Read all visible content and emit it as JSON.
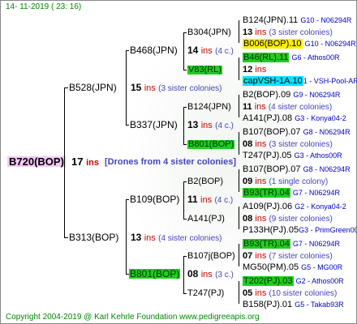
{
  "header": "14- 11-2019 ( 23: 16)",
  "footer": "Copyright 2004-2019 @ Karl Kehrle Foundation   www.pedigreeapis.org",
  "root": {
    "name": "B720(BOP)",
    "count": "17",
    "ins": "ins",
    "note": "[Drones from 4 sister colonies]"
  },
  "gen1": [
    {
      "name": "B528(JPN)",
      "count": "15",
      "ins": "ins",
      "note": "(3 sister colonies)"
    },
    {
      "name": "B313(BOP)",
      "count": "13",
      "ins": "ins",
      "note": "(4 sister colonies)"
    }
  ],
  "gen2": [
    {
      "name": "B468(JPN)",
      "count": "14",
      "ins": "ins",
      "note": "(4 c.)"
    },
    {
      "name": "B337(JPN)",
      "count": "13",
      "ins": "ins",
      "note": "(4 c.)"
    },
    {
      "name": "B109(BOP)",
      "count": "11",
      "ins": "ins",
      "note": "(4 c.)"
    },
    {
      "name": "B801(BOP)",
      "count": "08",
      "ins": "ins",
      "note": "(3 c.)"
    }
  ],
  "gen3": [
    {
      "name": "B304(JPN)",
      "count": "",
      "ins": "",
      "note": ""
    },
    {
      "name": "V83(RL)",
      "count": "12",
      "ins": "ins",
      "note": ""
    },
    {
      "name": "B124(JPN)",
      "count": "",
      "ins": "",
      "note": ""
    },
    {
      "name": "B801(BOP)",
      "count": "",
      "ins": "",
      "note": ""
    },
    {
      "name": "B2(BOP)",
      "count": "",
      "ins": "",
      "note": ""
    },
    {
      "name": "A141(PJ)",
      "count": "",
      "ins": "",
      "note": ""
    },
    {
      "name": "B107j(BOP)",
      "count": "",
      "ins": "",
      "note": ""
    },
    {
      "name": "T247(PJ)",
      "count": "",
      "ins": "",
      "note": ""
    }
  ],
  "gen4": [
    {
      "name": "B124(JPN).11",
      "code": "G10 - N06294R"
    },
    {
      "name": "13",
      "ins": "ins",
      "note": "(3 sister colonies)"
    },
    {
      "name": "B006(BOP).10",
      "code": "G10 - N06294R"
    },
    {
      "name": "B46(RL).11",
      "code": "G6 - Athos00R"
    },
    {
      "name": "12",
      "ins": "ins"
    },
    {
      "name": "capVSH-1A.10",
      "code": "1 - VSH-Pool-AR"
    },
    {
      "name": "B2(BOP).09",
      "code": "G9 - N06294R"
    },
    {
      "name": "11",
      "ins": "ins",
      "note": "(4 sister colonies)"
    },
    {
      "name": "A141(PJ).08",
      "code": "G3 - Konya04-2"
    },
    {
      "name": "B107(BOP).07",
      "code": "G8 - N06294R"
    },
    {
      "name": "08",
      "ins": "ins",
      "note": "(3 sister colonies)"
    },
    {
      "name": "T247(PJ).05",
      "code": "G3 - Athos00R"
    },
    {
      "name": "B107(BOP).07",
      "code": "G8 - N06294R"
    },
    {
      "name": "09",
      "ins": "ins",
      "note": "(1 single colony)"
    },
    {
      "name": "B93(TR).04",
      "code": "G7 - N06294R"
    },
    {
      "name": "A109(PJ).06",
      "code": "G2 - Konya04-2"
    },
    {
      "name": "08",
      "ins": "ins",
      "note": "(9 sister colonies)"
    },
    {
      "name": "P133H(PJ).05",
      "code": "G3 - PrimGreen00"
    },
    {
      "name": "B93(TR).04",
      "code": "G7 - N06294R"
    },
    {
      "name": "07",
      "ins": "ins",
      "note": "(7 sister colonies)"
    },
    {
      "name": "MG50(PM).05",
      "code": "G5 - MG00R"
    },
    {
      "name": "T202(PJ).03",
      "code": "G2 - Athos00R"
    },
    {
      "name": "05",
      "ins": "ins",
      "note": "(10 sister colonies)"
    },
    {
      "name": "B158(PJ).01",
      "code": "G5 - Takab93R"
    }
  ],
  "colors": {
    "green": "#22cc22",
    "yellow": "#ffee00",
    "cyan": "#00e5ff",
    "pink": "#f4c8f4",
    "red": "#cc0000",
    "blue": "#0000cc"
  }
}
